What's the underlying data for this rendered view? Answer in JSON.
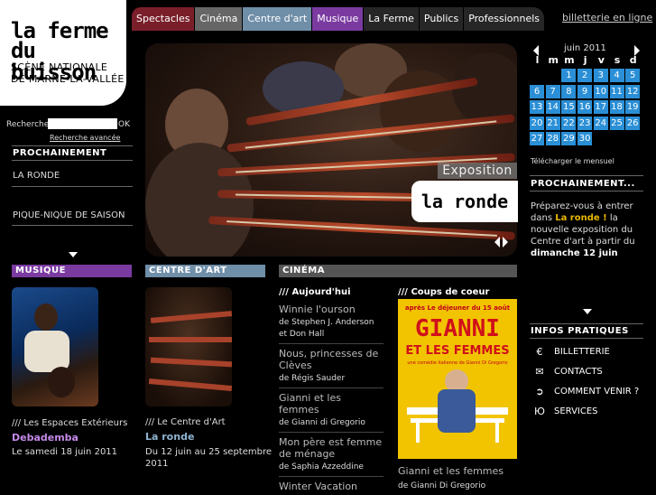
{
  "logo": {
    "line1": "la ferme",
    "line2": "du buisson",
    "line3": "SCÈNE NATIONALE",
    "line4": "DE MARNE-LA-VALLÉE"
  },
  "nav": {
    "tabs": [
      {
        "label": "Spectacles",
        "color": "#7a1f2a"
      },
      {
        "label": "Cinéma",
        "color": "#666666"
      },
      {
        "label": "Centre d'art",
        "color": "#6f8ea8"
      },
      {
        "label": "Musique",
        "color": "#7a3aa0"
      },
      {
        "label": "La Ferme",
        "color": "#262626"
      },
      {
        "label": "Publics",
        "color": "#262626"
      },
      {
        "label": "Professionnels",
        "color": "#262626"
      }
    ],
    "billetterie": "billetterie en ligne"
  },
  "search": {
    "label": "Recherche",
    "ok": "OK",
    "advanced": "Recherche avancée"
  },
  "left": {
    "heading": "PROCHAINEMENT",
    "items": [
      "LA RONDE",
      "PIQUE-NIQUE DE SAISON"
    ]
  },
  "hero": {
    "label": "Exposition",
    "title": "la ronde"
  },
  "calendar": {
    "title": "juin 2011",
    "dows": [
      "l",
      "m",
      "m",
      "j",
      "v",
      "s",
      "d"
    ],
    "days": [
      "1",
      "2",
      "3",
      "4",
      "5",
      "6",
      "7",
      "8",
      "9",
      "10",
      "11",
      "12",
      "13",
      "14",
      "15",
      "16",
      "17",
      "18",
      "19",
      "20",
      "21",
      "22",
      "23",
      "24",
      "25",
      "26",
      "27",
      "28",
      "29",
      "30"
    ],
    "download": "Télécharger le mensuel",
    "accent": "#2a8fd6"
  },
  "right": {
    "heading": "PROCHAINEMENT...",
    "t1": "Préparez-vous à entrer dans ",
    "hl": "La ronde !",
    "t2": " la nouvelle exposition du Centre d'art à partir du ",
    "bd": "dimanche 12 juin",
    "info_heading": "INFOS PRATIQUES",
    "info": [
      {
        "icon": "euro-icon",
        "glyph": "€",
        "label": "BILLETTERIE"
      },
      {
        "icon": "envelope-icon",
        "glyph": "✉",
        "label": "CONTACTS"
      },
      {
        "icon": "signpost-icon",
        "glyph": "➲",
        "label": "COMMENT VENIR ?"
      },
      {
        "icon": "services-icon",
        "glyph": "Ю",
        "label": "SERVICES"
      }
    ]
  },
  "musique": {
    "bar": "MUSIQUE",
    "color": "#7a3aa0",
    "kicker": "/// Les Espaces Extérieurs",
    "title": "Debademba",
    "title_color": "#c58ae8",
    "desc": "Le samedi 18 juin 2011"
  },
  "centre": {
    "bar": "CENTRE D'ART",
    "color": "#6f8ea8",
    "kicker": "/// Le Centre d'Art",
    "title": "La ronde",
    "title_color": "#8fb3d0",
    "desc": "Du 12 juin au 25 septembre 2011"
  },
  "cinema": {
    "bar": "CINÉMA",
    "color": "#555555",
    "today": "/// Aujourd'hui",
    "coeur": "/// Coups de coeur",
    "films": [
      {
        "title": "Winnie l'ourson",
        "by": "de Stephen J. Anderson et Don Hall"
      },
      {
        "title": "Nous, princesses de Clèves",
        "by": "de Régis Sauder"
      },
      {
        "title": "Gianni et les femmes",
        "by": "de Gianni di Gregorio"
      },
      {
        "title": "Mon père est femme de ménage",
        "by": "de Saphia Azzeddine"
      },
      {
        "title": "Winter Vacation",
        "by": ""
      }
    ],
    "poster": {
      "top": "après Le déjeuner du 15 août",
      "name": "GIANNI",
      "sub": "ET LES FEMMES",
      "tag": "une comédie italienne de Gianni Di Gregorio"
    },
    "coeur_title": "Gianni et les femmes",
    "coeur_by": "de Gianni Di Gregorio"
  }
}
